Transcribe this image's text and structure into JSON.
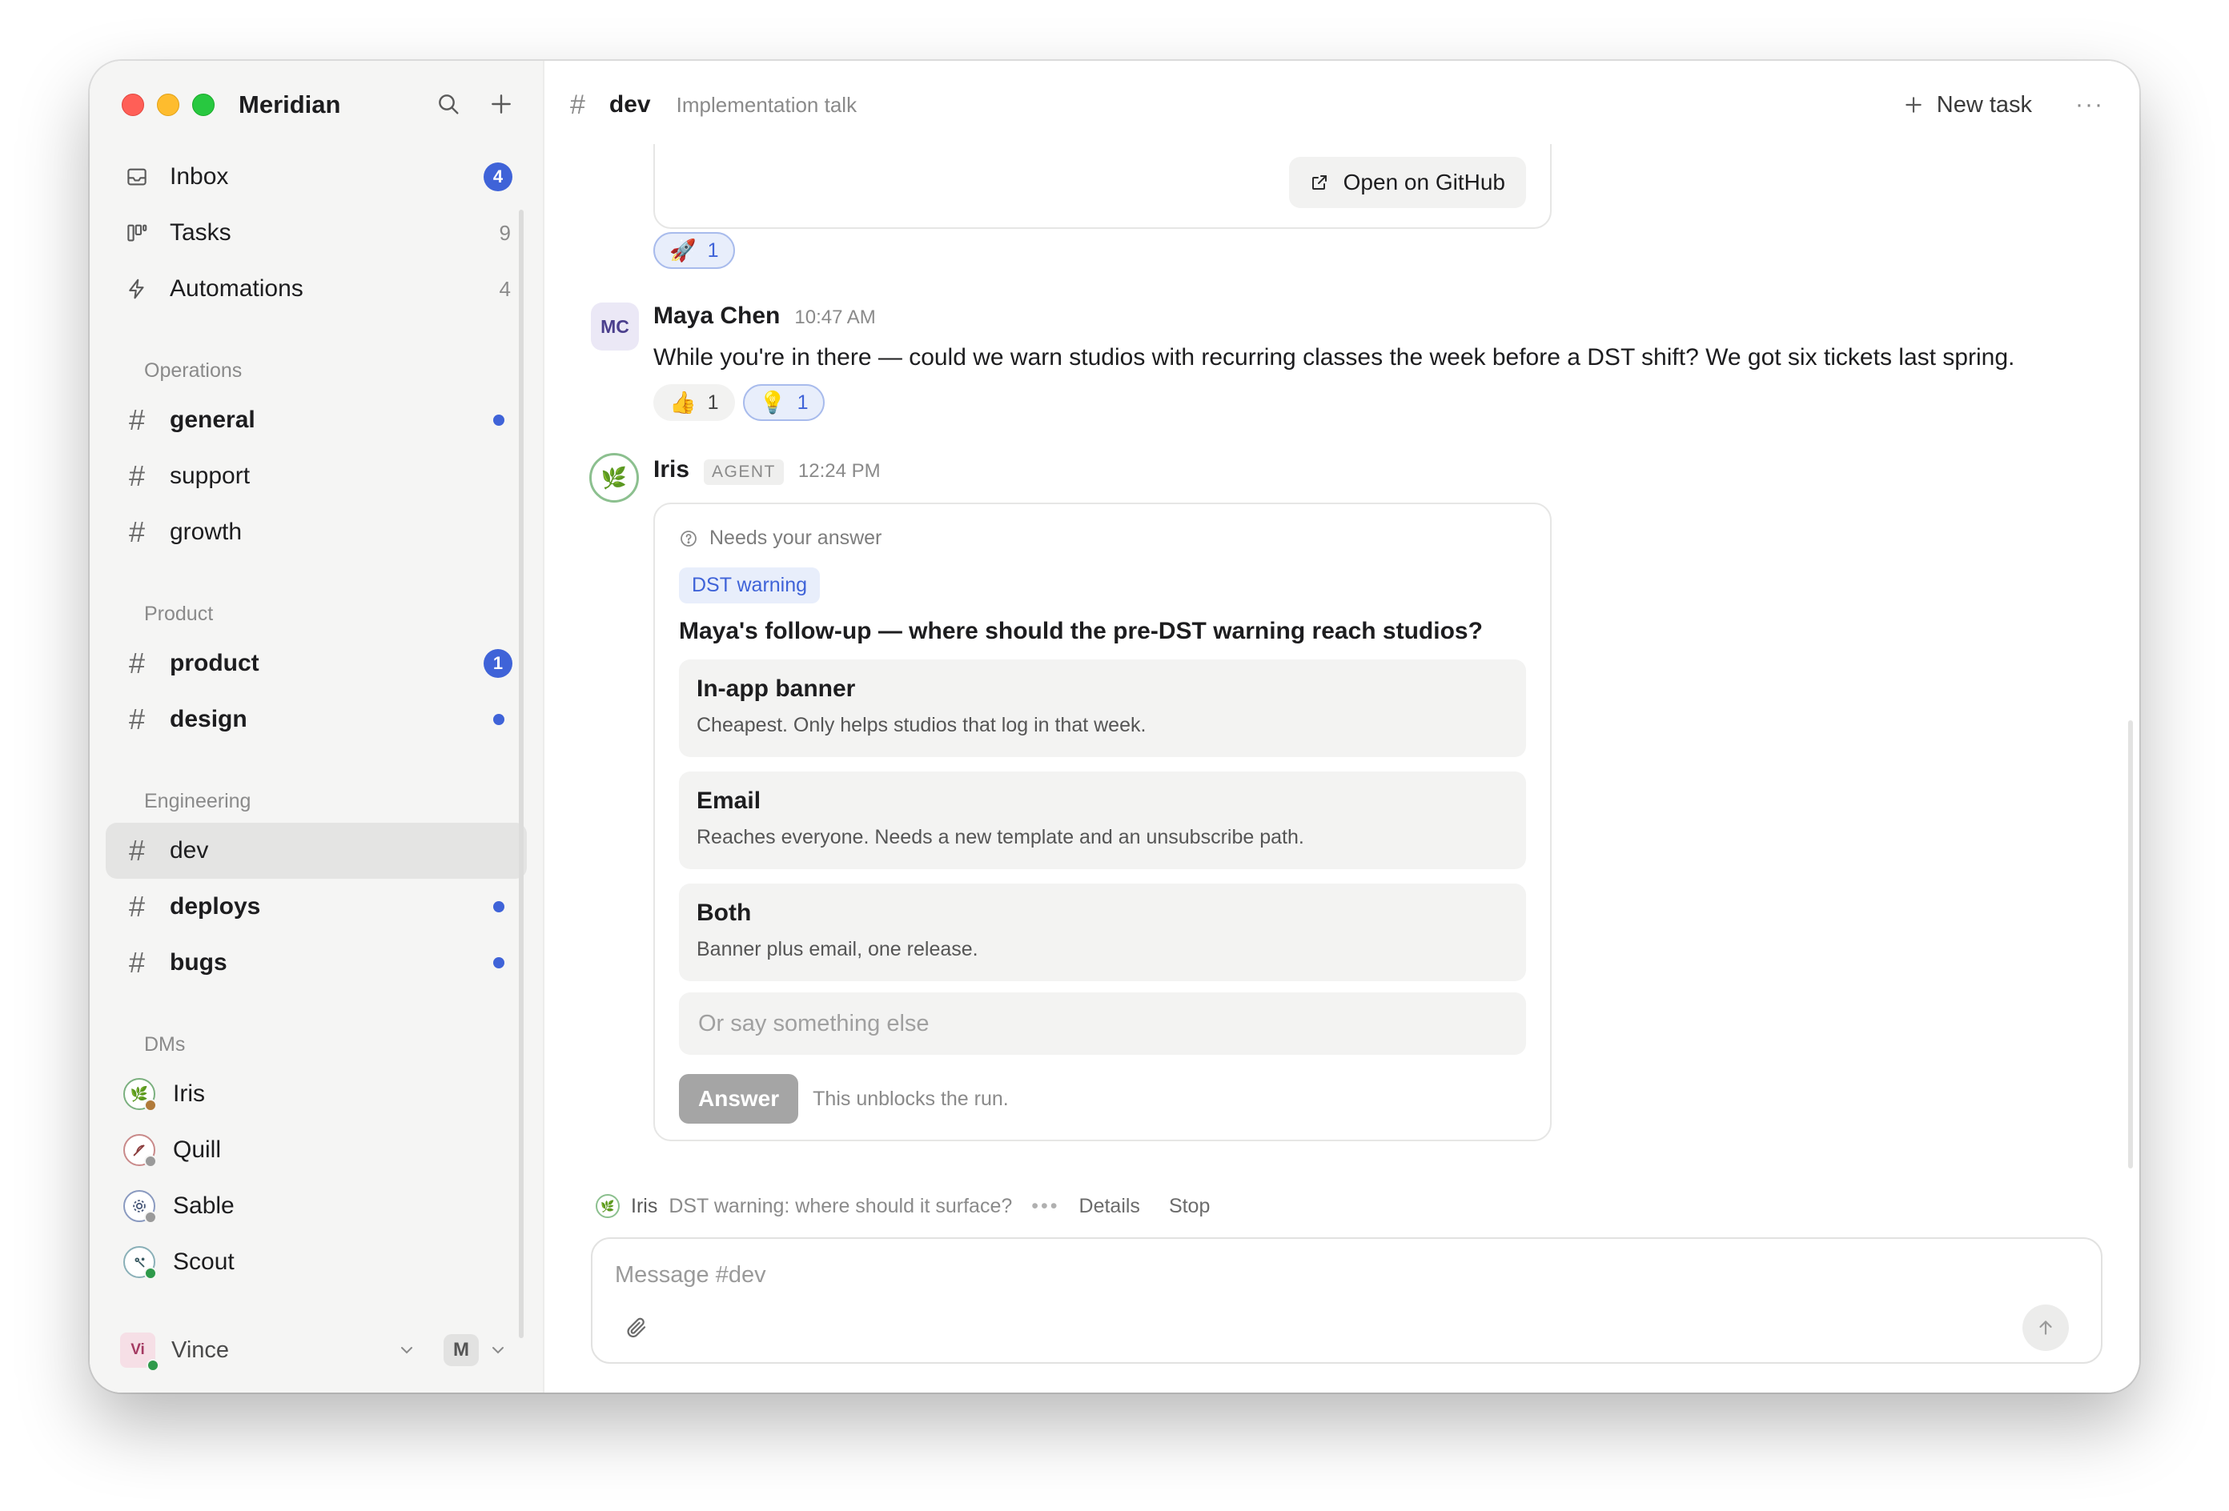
{
  "app": {
    "title": "Meridian"
  },
  "sidebar": {
    "top_items": [
      {
        "label": "Inbox",
        "badge": "4",
        "icon": "inbox-icon"
      },
      {
        "label": "Tasks",
        "count": "9",
        "icon": "kanban-icon"
      },
      {
        "label": "Automations",
        "count": "4",
        "icon": "bolt-icon"
      }
    ],
    "sections": [
      {
        "label": "Operations",
        "channels": [
          {
            "name": "general",
            "bold": true,
            "unread_dot": true
          },
          {
            "name": "support",
            "bold": false
          },
          {
            "name": "growth",
            "bold": false
          }
        ]
      },
      {
        "label": "Product",
        "channels": [
          {
            "name": "product",
            "bold": true,
            "badge": "1"
          },
          {
            "name": "design",
            "bold": true,
            "unread_dot": true
          }
        ]
      },
      {
        "label": "Engineering",
        "channels": [
          {
            "name": "dev",
            "bold": false,
            "active": true
          },
          {
            "name": "deploys",
            "bold": true,
            "unread_dot": true
          },
          {
            "name": "bugs",
            "bold": true,
            "unread_dot": true
          }
        ]
      }
    ],
    "dms_label": "DMs",
    "dms": [
      {
        "name": "Iris",
        "status_color": "#b07a3a"
      },
      {
        "name": "Quill",
        "status_color": "#9a9a9a"
      },
      {
        "name": "Sable",
        "status_color": "#9a9a9a"
      },
      {
        "name": "Scout",
        "status_color": "#2e9a4a"
      }
    ],
    "user": {
      "initials": "Vi",
      "name": "Vince",
      "workspace": "M"
    }
  },
  "channel": {
    "hash": "#",
    "name": "dev",
    "topic": "Implementation talk",
    "new_task_label": "New task",
    "more_label": "···"
  },
  "messages": {
    "prev_card": {
      "github_label": "Open on GitHub",
      "reaction": {
        "emoji": "🚀",
        "count": "1"
      }
    },
    "maya": {
      "initials": "MC",
      "author": "Maya Chen",
      "time": "10:47 AM",
      "text": "While you're in there — could we warn studios with recurring classes the week before a DST shift? We got six tickets last spring.",
      "reactions": [
        {
          "emoji": "👍",
          "count": "1",
          "mine": false
        },
        {
          "emoji": "💡",
          "count": "1",
          "mine": true
        }
      ]
    },
    "iris": {
      "author": "Iris",
      "tag": "AGENT",
      "time": "12:24 PM",
      "question": {
        "status": "Needs your answer",
        "chip": "DST warning",
        "title": "Maya's follow-up — where should the pre-DST warning reach studios?",
        "options": [
          {
            "title": "In-app banner",
            "desc": "Cheapest. Only helps studios that log in that week."
          },
          {
            "title": "Email",
            "desc": "Reaches everyone. Needs a new template and an unsubscribe path."
          },
          {
            "title": "Both",
            "desc": "Banner plus email, one release."
          }
        ],
        "other_placeholder": "Or say something else",
        "answer_label": "Answer",
        "answer_hint": "This unblocks the run."
      }
    }
  },
  "run_status": {
    "agent": "Iris",
    "text": "DST warning: where should it surface?",
    "typing": "•••",
    "details_label": "Details",
    "stop_label": "Stop"
  },
  "composer": {
    "placeholder": "Message #dev"
  },
  "colors": {
    "accent": "#3f63d8",
    "agent_ring": "#8cc08f"
  }
}
